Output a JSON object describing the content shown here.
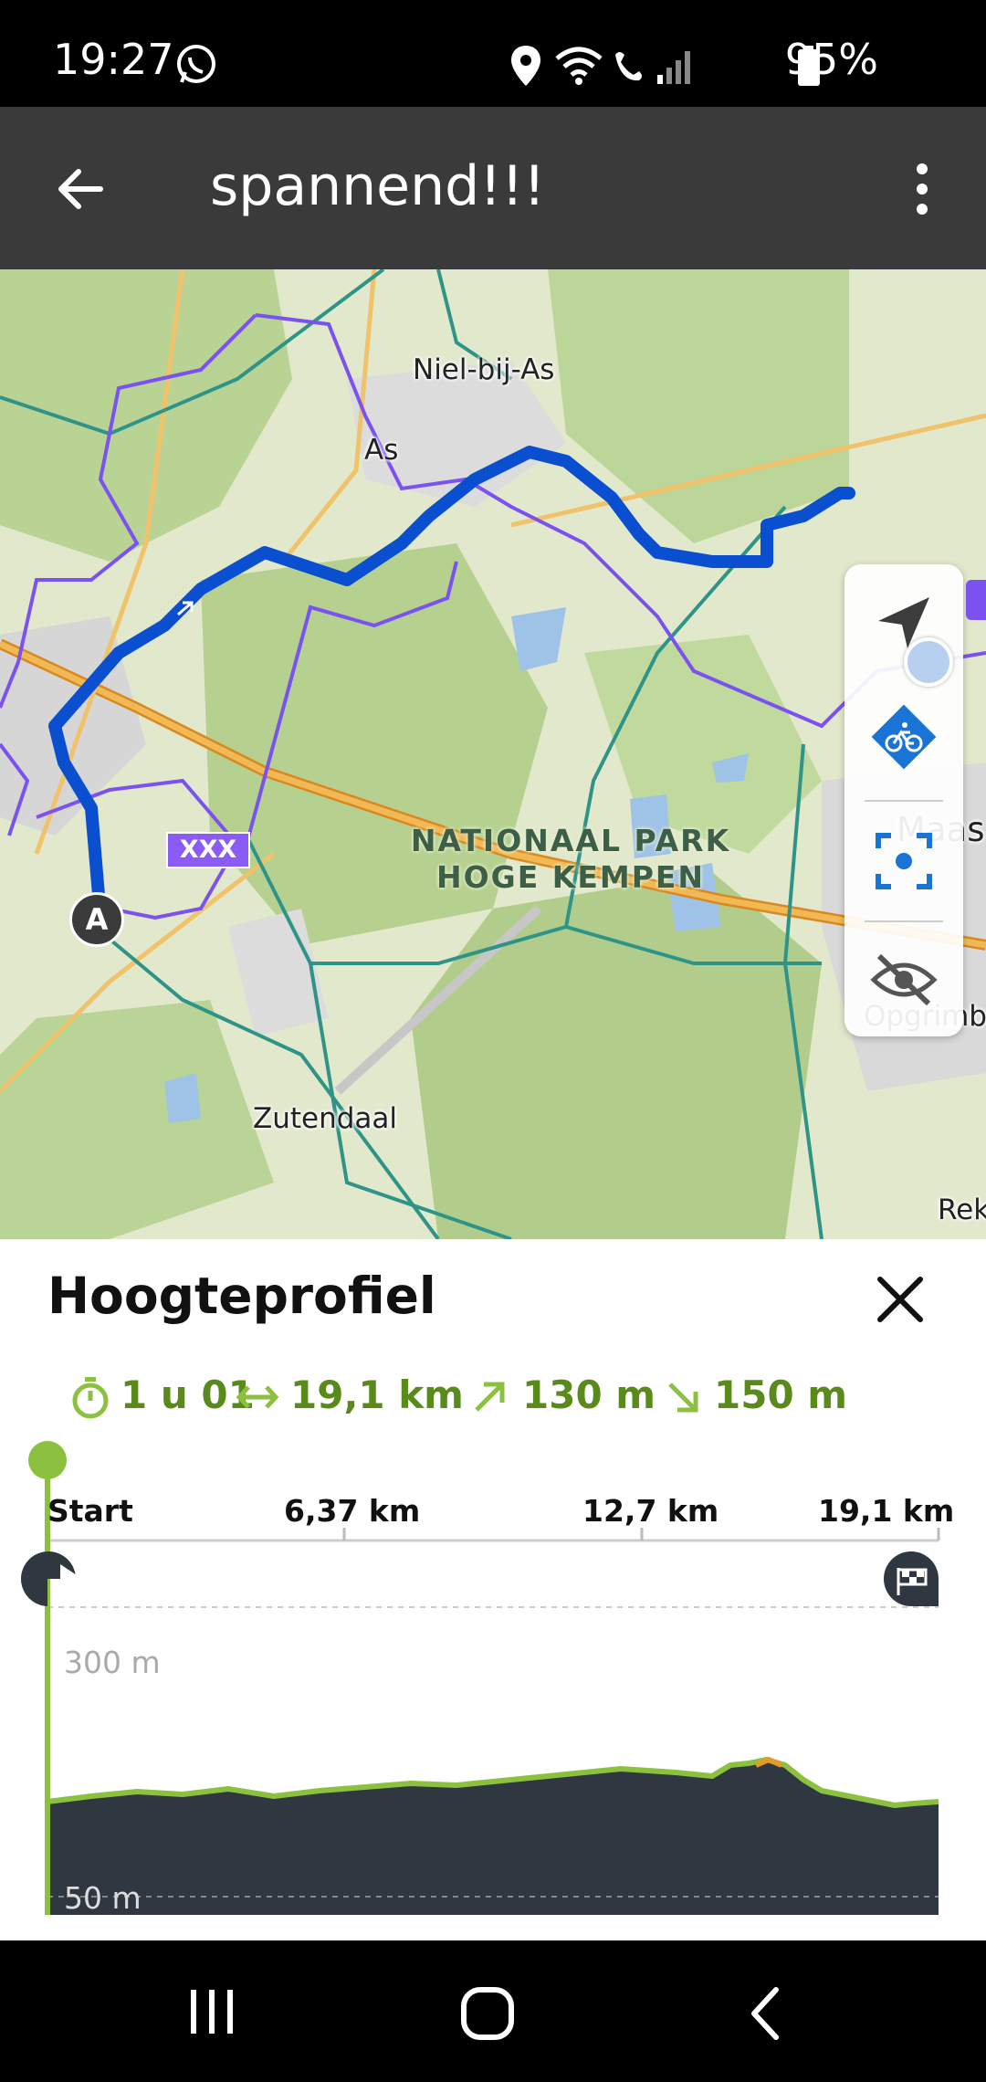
{
  "status_bar": {
    "time": "19:27",
    "battery": "95%"
  },
  "toolbar": {
    "title": "spannend!!!"
  },
  "map": {
    "labels": {
      "niel_bij_as": "Niel-bij-As",
      "as": "As",
      "park_line1": "NATIONAAL PARK",
      "park_line2": "HOGE KEMPEN",
      "maas": "Maas",
      "opgrimb": "Opgrimb",
      "zutendaal": "Zutendaal",
      "rek": "Rek",
      "route_badge": "XXX",
      "start_marker": "A"
    },
    "colors": {
      "route": "#0b4fd1",
      "boundary": "#7c4dff",
      "road": "#e7a73a",
      "trail": "#2a8a7a"
    }
  },
  "elevation_panel": {
    "title": "Hoogteprofiel",
    "stats": {
      "duration": "1 u 01",
      "distance": "19,1 km",
      "ascent": "130 m",
      "descent": "150 m"
    },
    "axis": {
      "start": "Start",
      "t1": "6,37 km",
      "t2": "12,7 km",
      "t3": "19,1 km"
    },
    "y_labels": {
      "top": "300 m",
      "bottom": "50 m"
    },
    "colors": {
      "accent": "#8cc13f",
      "fill": "#2f3740",
      "stats": "#5a8a1c"
    }
  }
}
